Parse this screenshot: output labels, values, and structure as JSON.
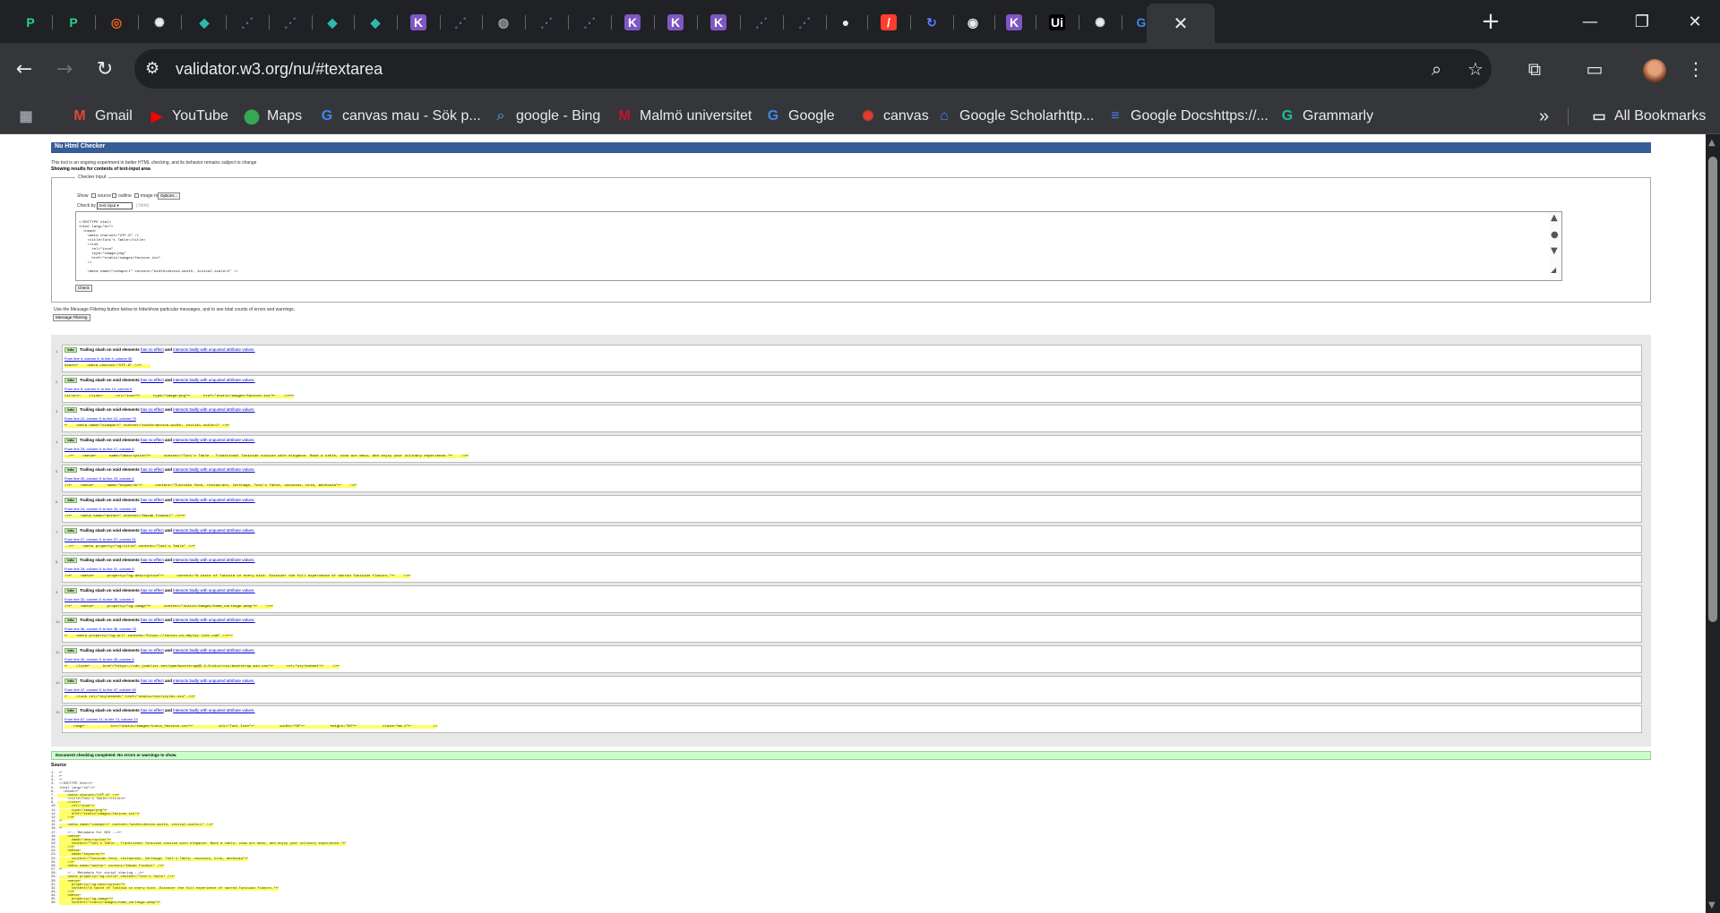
{
  "browser": {
    "tabs": [
      {
        "icon": "pycharm-icon",
        "color": "#21d789",
        "glyph": "P"
      },
      {
        "icon": "pycharm-icon",
        "color": "#21d789",
        "glyph": "P"
      },
      {
        "icon": "target-icon",
        "color": "#f26522",
        "glyph": "◎"
      },
      {
        "icon": "openai-icon",
        "color": "#e8eaed",
        "glyph": "✺"
      },
      {
        "icon": "diamond-icon",
        "color": "#2bbbad",
        "glyph": "◆"
      },
      {
        "icon": "dots-icon",
        "color": "#4a7ab8",
        "glyph": "⋰"
      },
      {
        "icon": "dots-icon",
        "color": "#4a7ab8",
        "glyph": "⋰"
      },
      {
        "icon": "diamond-icon",
        "color": "#2bbbad",
        "glyph": "◆"
      },
      {
        "icon": "diamond-icon",
        "color": "#2bbbad",
        "glyph": "◆"
      },
      {
        "icon": "k-icon",
        "color": "#7e57c2",
        "glyph": "K"
      },
      {
        "icon": "dots-icon",
        "color": "#4a7ab8",
        "glyph": "⋰"
      },
      {
        "icon": "globe-icon",
        "color": "#9aa0a6",
        "glyph": "◍"
      },
      {
        "icon": "dots-icon",
        "color": "#4a7ab8",
        "glyph": "⋰"
      },
      {
        "icon": "dots-icon",
        "color": "#4a7ab8",
        "glyph": "⋰"
      },
      {
        "icon": "k-icon",
        "color": "#7e57c2",
        "glyph": "K"
      },
      {
        "icon": "k-icon",
        "color": "#7e57c2",
        "glyph": "K"
      },
      {
        "icon": "k-icon",
        "color": "#7e57c2",
        "glyph": "K"
      },
      {
        "icon": "dots-icon",
        "color": "#4a7ab8",
        "glyph": "⋰"
      },
      {
        "icon": "dots-icon",
        "color": "#4a7ab8",
        "glyph": "⋰"
      },
      {
        "icon": "github-icon",
        "color": "#e8eaed",
        "glyph": "●"
      },
      {
        "icon": "slash-icon",
        "color": "#ff3d2e",
        "glyph": "/"
      },
      {
        "icon": "sync-icon",
        "color": "#5c7cfa",
        "glyph": "↻"
      },
      {
        "icon": "chrome-icon",
        "color": "#e8eaed",
        "glyph": "◉"
      },
      {
        "icon": "k-icon",
        "color": "#7e57c2",
        "glyph": "K"
      },
      {
        "icon": "udemy-icon",
        "color": "#000000",
        "glyph": "Ui"
      },
      {
        "icon": "openai-icon",
        "color": "#e8eaed",
        "glyph": "✺"
      },
      {
        "icon": "google-icon",
        "color": "#4285f4",
        "glyph": "G"
      }
    ],
    "window_controls": {
      "minimize": "—",
      "restore": "❐",
      "close": "✕"
    },
    "url": "validator.w3.org/nu/#textarea",
    "bookmarks": [
      {
        "label": "",
        "icon": "apps-icon",
        "color": "#9aa0a6",
        "glyph": "▦"
      },
      {
        "label": "Gmail",
        "icon": "gmail-icon",
        "color": "#ea4335",
        "glyph": "M"
      },
      {
        "label": "YouTube",
        "icon": "youtube-icon",
        "color": "#ff0000",
        "glyph": "▶"
      },
      {
        "label": "Maps",
        "icon": "maps-icon",
        "color": "#34a853",
        "glyph": "⬤"
      },
      {
        "label": "canvas mau - Sök p...",
        "icon": "google-icon",
        "color": "#4285f4",
        "glyph": "G"
      },
      {
        "label": "google - Bing",
        "icon": "search-icon",
        "color": "#4a7ab8",
        "glyph": "⌕"
      },
      {
        "label": "Malmö universitet",
        "icon": "mau-icon",
        "color": "#c8102e",
        "glyph": "M"
      },
      {
        "label": "Google",
        "icon": "google-icon",
        "color": "#4285f4",
        "glyph": "G"
      },
      {
        "label": "canvas",
        "icon": "canvas-icon",
        "color": "#e03e2d",
        "glyph": "✺"
      },
      {
        "label": "Google Scholarhttp...",
        "icon": "scholar-icon",
        "color": "#4285f4",
        "glyph": "⌂"
      },
      {
        "label": "Google Docshttps://...",
        "icon": "docs-icon",
        "color": "#4285f4",
        "glyph": "≡"
      },
      {
        "label": "Grammarly",
        "icon": "grammarly-icon",
        "color": "#15c39a",
        "glyph": "G"
      }
    ],
    "bookmarks_overflow": "»",
    "all_bookmarks": "All Bookmarks"
  },
  "validator": {
    "title": "Nu Html Checker",
    "intro": "This tool is an ongoing experiment in better HTML checking, and its behavior remains subject to change",
    "showing": "Showing results for contents of text-input area",
    "checker_input_legend": "Checker Input",
    "show_label": "Show",
    "show_options": [
      "source",
      "outline",
      "image report"
    ],
    "options_button": "Options...",
    "check_by_label": "Check by",
    "check_by_value": "text input",
    "check_by_hint": "(.html)",
    "textarea_source": "<!DOCTYPE html>\n<html lang=\"en\">\n  <head>\n    <meta charset=\"UTF-8\" />\n    <title>Tuni's Table</title>\n    <link\n      rel=\"icon\"\n      type=\"image/png\"\n      href=\"static/images/favicon.ico\"\n    />\n\n    <meta name=\"viewport\" content=\"width=device-width, initial-scale=1\" />",
    "check_button": "Check",
    "filter_hint": "Use the Message Filtering button below to hide/show particular messages, and to see total counts of errors and warnings.",
    "filter_button": "Message Filtering",
    "messages": [
      {
        "num": "1.",
        "type": "Info",
        "text": "Trailing slash on void elements",
        "link1": "has no effect",
        "and": "and",
        "link2": "interacts badly with unquoted attribute values.",
        "location": "From line 4, column 5; to line 4, column 30",
        "extract": "head>↩    <meta charset=\"UTF-8\" />↩    "
      },
      {
        "num": "2.",
        "type": "Info",
        "text": "Trailing slash on void elements",
        "link1": "has no effect",
        "and": "and",
        "link2": "interacts badly with unquoted attribute values.",
        "location": "From line 6, column 5; to line 10, column 6",
        "extract": "title>↩    <link↩      rel=\"icon\"↩      type=\"image/png\"↩      href=\"static/images/favicon.ico\"↩    />↩↩"
      },
      {
        "num": "3.",
        "type": "Info",
        "text": "Trailing slash on void elements",
        "link1": "has no effect",
        "and": "and",
        "link2": "interacts badly with unquoted attribute values.",
        "location": "From line 12, column 5; to line 12, column 75",
        "extract": "↩    <meta name=\"viewport\" content=\"width=device-width, initial-scale=1\" />↩"
      },
      {
        "num": "4.",
        "type": "Info",
        "text": "Trailing slash on void elements",
        "link1": "has no effect",
        "and": "and",
        "link2": "interacts badly with unquoted attribute values.",
        "location": "From line 15, column 5; to line 17, column 6",
        "extract": "-->↩    <meta↩      name=\"description\"↩      content=\"Tuni's Table - Traditional Tunisian cuisine with elegance. Book a table, view our menu, and enjoy your culinary experience.\"↩    />↩"
      },
      {
        "num": "5.",
        "type": "Info",
        "text": "Trailing slash on void elements",
        "link1": "has no effect",
        "and": "and",
        "link2": "interacts badly with unquoted attribute values.",
        "location": "From line 20, column 5; to line 23, column 6",
        "extract": "/>↩    <meta↩      name=\"keywords\"↩      content=\"Tunisian food, restaurant, Carthage, Tuni's Table, couscous, brik, mechouia\"↩    />↩"
      },
      {
        "num": "6.",
        "type": "Info",
        "text": "Trailing slash on void elements",
        "link1": "has no effect",
        "and": "and",
        "link2": "interacts badly with unquoted attribute values.",
        "location": "From line 24, column 5; to line 24, column 45",
        "extract": "/>↩    <meta name=\"author\" content=\"Nasab Fienbol\" />↩↩"
      },
      {
        "num": "7.",
        "type": "Info",
        "text": "Trailing slash on void elements",
        "link1": "has no effect",
        "and": "and",
        "link2": "interacts badly with unquoted attribute values.",
        "location": "From line 27, column 5; to line 27, column 51",
        "extract": "-->↩    <meta property=\"og:title\" content=\"Tuni's Table\" />↩"
      },
      {
        "num": "8.",
        "type": "Info",
        "text": "Trailing slash on void elements",
        "link1": "has no effect",
        "and": "and",
        "link2": "interacts badly with unquoted attribute values.",
        "location": "From line 28, column 5; to line 31, column 6",
        "extract": "/>↩    <meta↩      property=\"og:description\"↩      content=\"A taste of Tunisia in every bite. Discover the full experience of sacred Tunisian flavors.\"↩    />↩"
      },
      {
        "num": "9.",
        "type": "Info",
        "text": "Trailing slash on void elements",
        "link1": "has no effect",
        "and": "and",
        "link2": "interacts badly with unquoted attribute values.",
        "location": "From line 32, column 5; to line 35, column 6",
        "extract": "/>↩    <meta↩      property=\"og:image\"↩      content=\"static/images/home_carthage.webp\"↩    />↩"
      },
      {
        "num": "10.",
        "type": "Info",
        "text": "Trailing slash on void elements",
        "link1": "has no effect",
        "and": "and",
        "link2": "interacts badly with unquoted attribute values.",
        "location": "From line 36, column 5; to line 36, column 75",
        "extract": "↩    <meta property=\"og:url\" content=\"https://tuniss-on-deploy-link.com\" />↩↩"
      },
      {
        "num": "11.",
        "type": "Info",
        "text": "Trailing slash on void elements",
        "link1": "has no effect",
        "and": "and",
        "link2": "interacts badly with unquoted attribute values.",
        "location": "From line 40, column 5; to line 43, column 6",
        "extract": "↩    <link↩      href=\"https://cdn.jsdelivr.net/npm/bootstrap@5.3.0/dist/css/bootstrap.min.css\"↩      rel=\"stylesheet\"↩    />↩"
      },
      {
        "num": "12.",
        "type": "Info",
        "text": "Trailing slash on void elements",
        "link1": "has no effect",
        "and": "and",
        "link2": "interacts badly with unquoted attribute values.",
        "location": "From line 47, column 5; to line 47, column 60",
        "extract": "↩    <link rel=\"stylesheet\" href=\"static/css/styles.css\" />↩"
      },
      {
        "num": "13.",
        "type": "Info",
        "text": "Trailing slash on void elements",
        "link1": "has no effect",
        "and": "and",
        "link2": "interacts badly with unquoted attribute values.",
        "location": "From line 67, column 11; to line 74, column 13",
        "extract": "    <img↩            src=\"static/images/tunis_favicon.ico\"↩            alt=\"Tuni Icon\"↩            width=\"50\"↩            height=\"50\"↩            class=\"me-2\"↩          />"
      }
    ],
    "summary": "Document checking completed. No errors or warnings to show.",
    "source_label": "Source",
    "source_lines": [
      "1.  ↩",
      "2.  ↩",
      "3.  ↩",
      "4.  <!DOCTYPE html>↩",
      "5.  <html lang=\"en\">↩",
      "6.    <head>↩",
      "7.      <meta charset=\"UTF-8\" />↩",
      "8.      <title>Tuni's Table</title>↩",
      "9.      <link↩",
      "10.       rel=\"icon\"↩",
      "11.       type=\"image/png\"↩",
      "12.       href=\"static/images/favicon.ico\"↩",
      "13.     />↩",
      "14. ↩",
      "15.     <meta name=\"viewport\" content=\"width=device-width, initial-scale=1\" />↩",
      "16. ↩",
      "17.     <!-- Metadata for SEO -->↩",
      "18.     <meta↩",
      "19.       name=\"description\"↩",
      "20.       content=\"Tuni's Table - Traditional Tunisian cuisine with elegance. Book a table, view our menu, and enjoy your culinary experience.\"↩",
      "21.     />↩",
      "22.     <meta↩",
      "23.       name=\"keywords\"↩",
      "24.       content=\"Tunisian food, restaurant, Carthage, Tuni's Table, couscous, brik, mechouia\"↩",
      "25.     />↩",
      "26.     <meta name=\"author\" content=\"Nasab Fienbol\" />↩",
      "27. ↩",
      "28.     <!-- Metadata for social sharing -->↩",
      "29.     <meta property=\"og:title\" content=\"Tuni's Table\" />↩",
      "30.     <meta↩",
      "31.       property=\"og:description\"↩",
      "32.       content=\"A taste of Tunisia in every bite. Discover the full experience of sacred Tunisian flavors.\"↩",
      "33.     />↩",
      "34.     <meta↩",
      "35.       property=\"og:image\"↩",
      "36.       content=\"static/images/home_carthage.webp\"↩"
    ]
  }
}
